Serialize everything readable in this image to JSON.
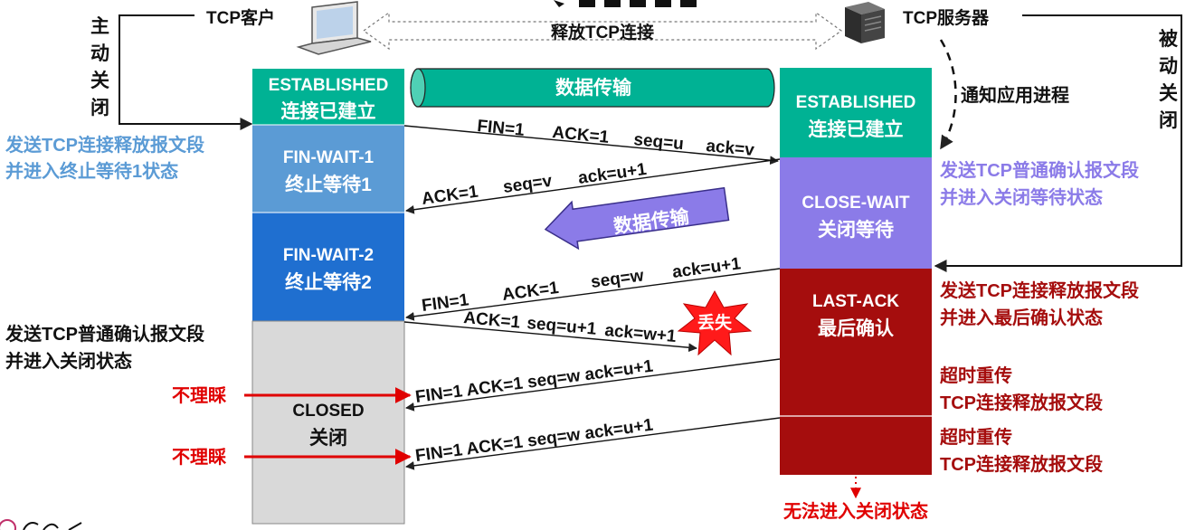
{
  "top": {
    "client_label": "TCP客户",
    "server_label": "TCP服务器",
    "release_label": "释放TCP连接",
    "active_close": "主动关闭",
    "passive_close": "被动关闭",
    "notify_app": "通知应用进程"
  },
  "client_states": [
    {
      "line1": "ESTABLISHED",
      "line2": "连接已建立",
      "color": "#00b294"
    },
    {
      "line1": "FIN-WAIT-1",
      "line2": "终止等待1",
      "color": "#5b9bd5"
    },
    {
      "line1": "FIN-WAIT-2",
      "line2": "终止等待2",
      "color": "#1f6fd0"
    },
    {
      "line1": "CLOSED",
      "line2": "关闭",
      "color": "#d9d9d9"
    }
  ],
  "server_states": [
    {
      "line1": "ESTABLISHED",
      "line2": "连接已建立",
      "color": "#00b294"
    },
    {
      "line1": "CLOSE-WAIT",
      "line2": "关闭等待",
      "color": "#8b7be8"
    },
    {
      "line1": "LAST-ACK",
      "line2": "最后确认",
      "color": "#a50d0d"
    }
  ],
  "transfer": {
    "label1": "数据传输",
    "label2": "数据传输"
  },
  "messages": [
    {
      "f1": "FIN=1",
      "f2": "ACK=1",
      "f3": "seq=u",
      "f4": "ack=v"
    },
    {
      "f1": "ACK=1",
      "f2": "seq=v",
      "f3": "ack=u+1"
    },
    {
      "f1": "FIN=1",
      "f2": "ACK=1",
      "f3": "seq=w",
      "f4": "ack=u+1"
    },
    {
      "f1": "ACK=1",
      "f2": "seq=u+1",
      "f3": "ack=w+1"
    },
    {
      "text": "FIN=1 ACK=1 seq=w ack=u+1"
    },
    {
      "text": "FIN=1 ACK=1 seq=w ack=u+1"
    }
  ],
  "lost_label": "丢失",
  "ignore_label": "不理睬",
  "notes": {
    "client_fin_1": "发送TCP连接释放报文段",
    "client_fin_2": "并进入终止等待1状态",
    "client_ack_1": "发送TCP普通确认报文段",
    "client_ack_2": "并进入关闭状态",
    "server_ack_1": "发送TCP普通确认报文段",
    "server_ack_2": "并进入关闭等待状态",
    "server_fin_1": "发送TCP连接释放报文段",
    "server_fin_2": "并进入最后确认状态",
    "retrans_1": "超时重传",
    "retrans_2": "TCP连接释放报文段",
    "retrans_3": "超时重传",
    "retrans_4": "TCP连接释放报文段",
    "cannot_close": "无法进入关闭状态"
  },
  "colors": {
    "blue_note": "#5b9bd5",
    "purple_note": "#8b7be8",
    "dark_red": "#a50d0d",
    "red": "#e00000"
  }
}
